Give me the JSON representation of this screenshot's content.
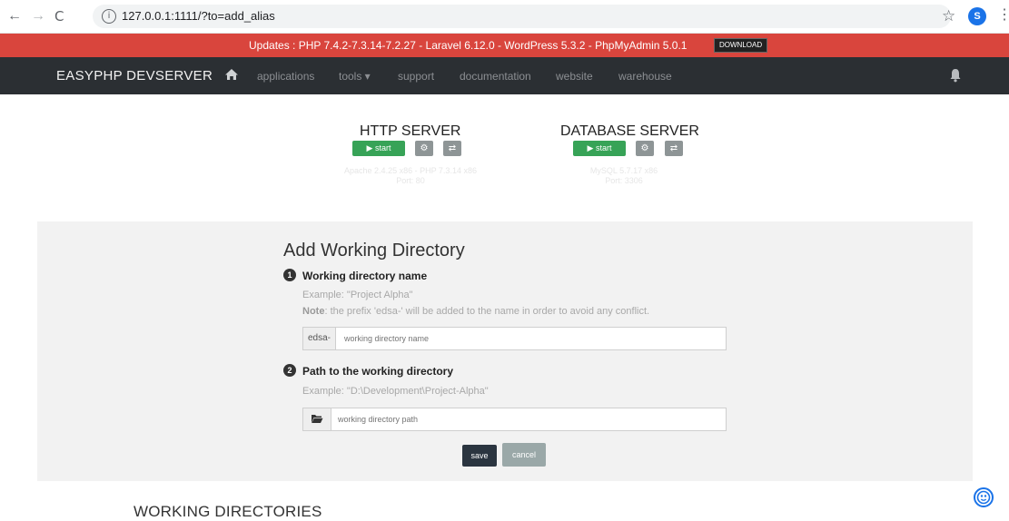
{
  "browser": {
    "url": "127.0.0.1:1111/?to=add_alias",
    "info_glyph": "i",
    "back_glyph": "←",
    "forward_glyph": "→",
    "reload_glyph": "C",
    "star_glyph": "☆",
    "profile_initial": "S",
    "menu_glyph": "⋮"
  },
  "updates": {
    "text": "Updates : PHP 7.4.2-7.3.14-7.2.27 - Laravel 6.12.0 - WordPress 5.3.2 - PhpMyAdmin 5.0.1",
    "download_label": "DOWNLOAD"
  },
  "navbar": {
    "brand": "EASYPHP DEVSERVER",
    "links": [
      "applications",
      "tools ▾",
      "support",
      "documentation",
      "website",
      "warehouse"
    ]
  },
  "http_server": {
    "title": "HTTP SERVER",
    "start_label": "▶ start",
    "settings_glyph": "⚙",
    "switch_glyph": "⇄",
    "info_line1": "Apache 2.4.25 x86 - PHP 7.3.14 x86",
    "info_line2": "Port: 80"
  },
  "database_server": {
    "title": "DATABASE SERVER",
    "start_label": "▶ start",
    "settings_glyph": "⚙",
    "switch_glyph": "⇄",
    "info_line1": "MySQL 5.7.17 x86",
    "info_line2": "Port: 3306"
  },
  "form": {
    "title": "Add Working Directory",
    "step1": {
      "number": "1",
      "label": "Working directory name",
      "example": "Example: \"Project Alpha\"",
      "note_label": "Note",
      "note_text": ": the prefix 'edsa-' will be added to the name in order to avoid any conflict.",
      "prefix": "edsa-",
      "placeholder": "working directory name"
    },
    "step2": {
      "number": "2",
      "label": "Path to the working directory",
      "example": "Example: \"D:\\Development\\Project-Alpha\"",
      "placeholder": "working directory path"
    },
    "save_label": "save",
    "cancel_label": "cancel"
  },
  "working_directories_heading": "WORKING DIRECTORIES",
  "colors": {
    "updates_bar": "#d9453d",
    "navbar": "#2b2f33",
    "start_button": "#37a357",
    "save_button": "#2b3540",
    "cancel_button": "#9aa8a8",
    "help_icon": "#1a73e8"
  },
  "icons": [
    "info-icon",
    "home-icon",
    "gear-icon",
    "switch-icon",
    "folder-icon",
    "bell-icon",
    "star-icon",
    "help-icon"
  ]
}
